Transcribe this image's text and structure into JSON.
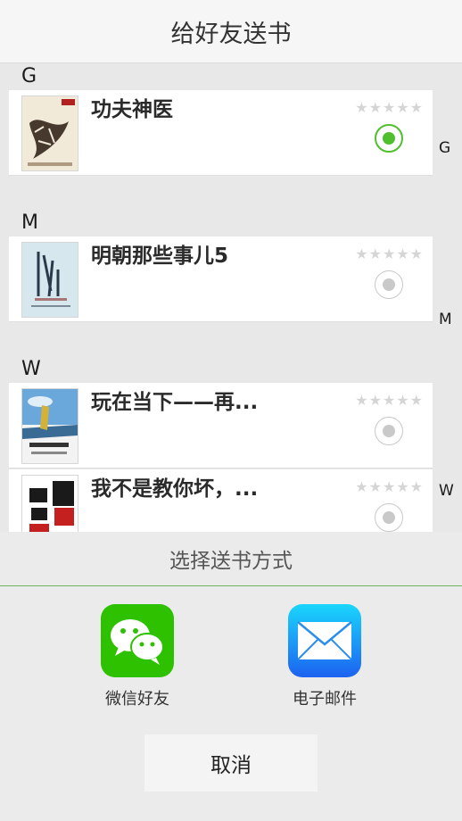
{
  "nav": {
    "title": "给好友送书"
  },
  "sections": [
    {
      "letter": "G",
      "books": [
        {
          "title": "功夫神医",
          "selected": true,
          "rating_stars": 0,
          "cover_icon": "book-cover-gongfu"
        }
      ]
    },
    {
      "letter": "M",
      "books": [
        {
          "title": "明朝那些事儿5",
          "selected": false,
          "rating_stars": 0,
          "cover_icon": "book-cover-mingchao"
        }
      ]
    },
    {
      "letter": "W",
      "books": [
        {
          "title": "玩在当下——再...",
          "selected": false,
          "rating_stars": 0,
          "cover_icon": "book-cover-wanzai"
        },
        {
          "title": "我不是教你坏，...",
          "selected": false,
          "rating_stars": 0,
          "cover_icon": "book-cover-wobushi"
        }
      ]
    }
  ],
  "stars_glyph": "★★★★★",
  "index_letters": [
    "G",
    "M",
    "W"
  ],
  "share_sheet": {
    "title": "选择送书方式",
    "options": [
      {
        "label": "微信好友",
        "icon": "wechat-icon",
        "color": "#2dc100"
      },
      {
        "label": "电子邮件",
        "icon": "mail-icon",
        "color": "#1a8cff"
      }
    ],
    "cancel_label": "取消"
  },
  "colors": {
    "accent_green": "#4fbf2d",
    "sheet_divider": "#6eb359",
    "star_gray": "#d5d5d5"
  }
}
